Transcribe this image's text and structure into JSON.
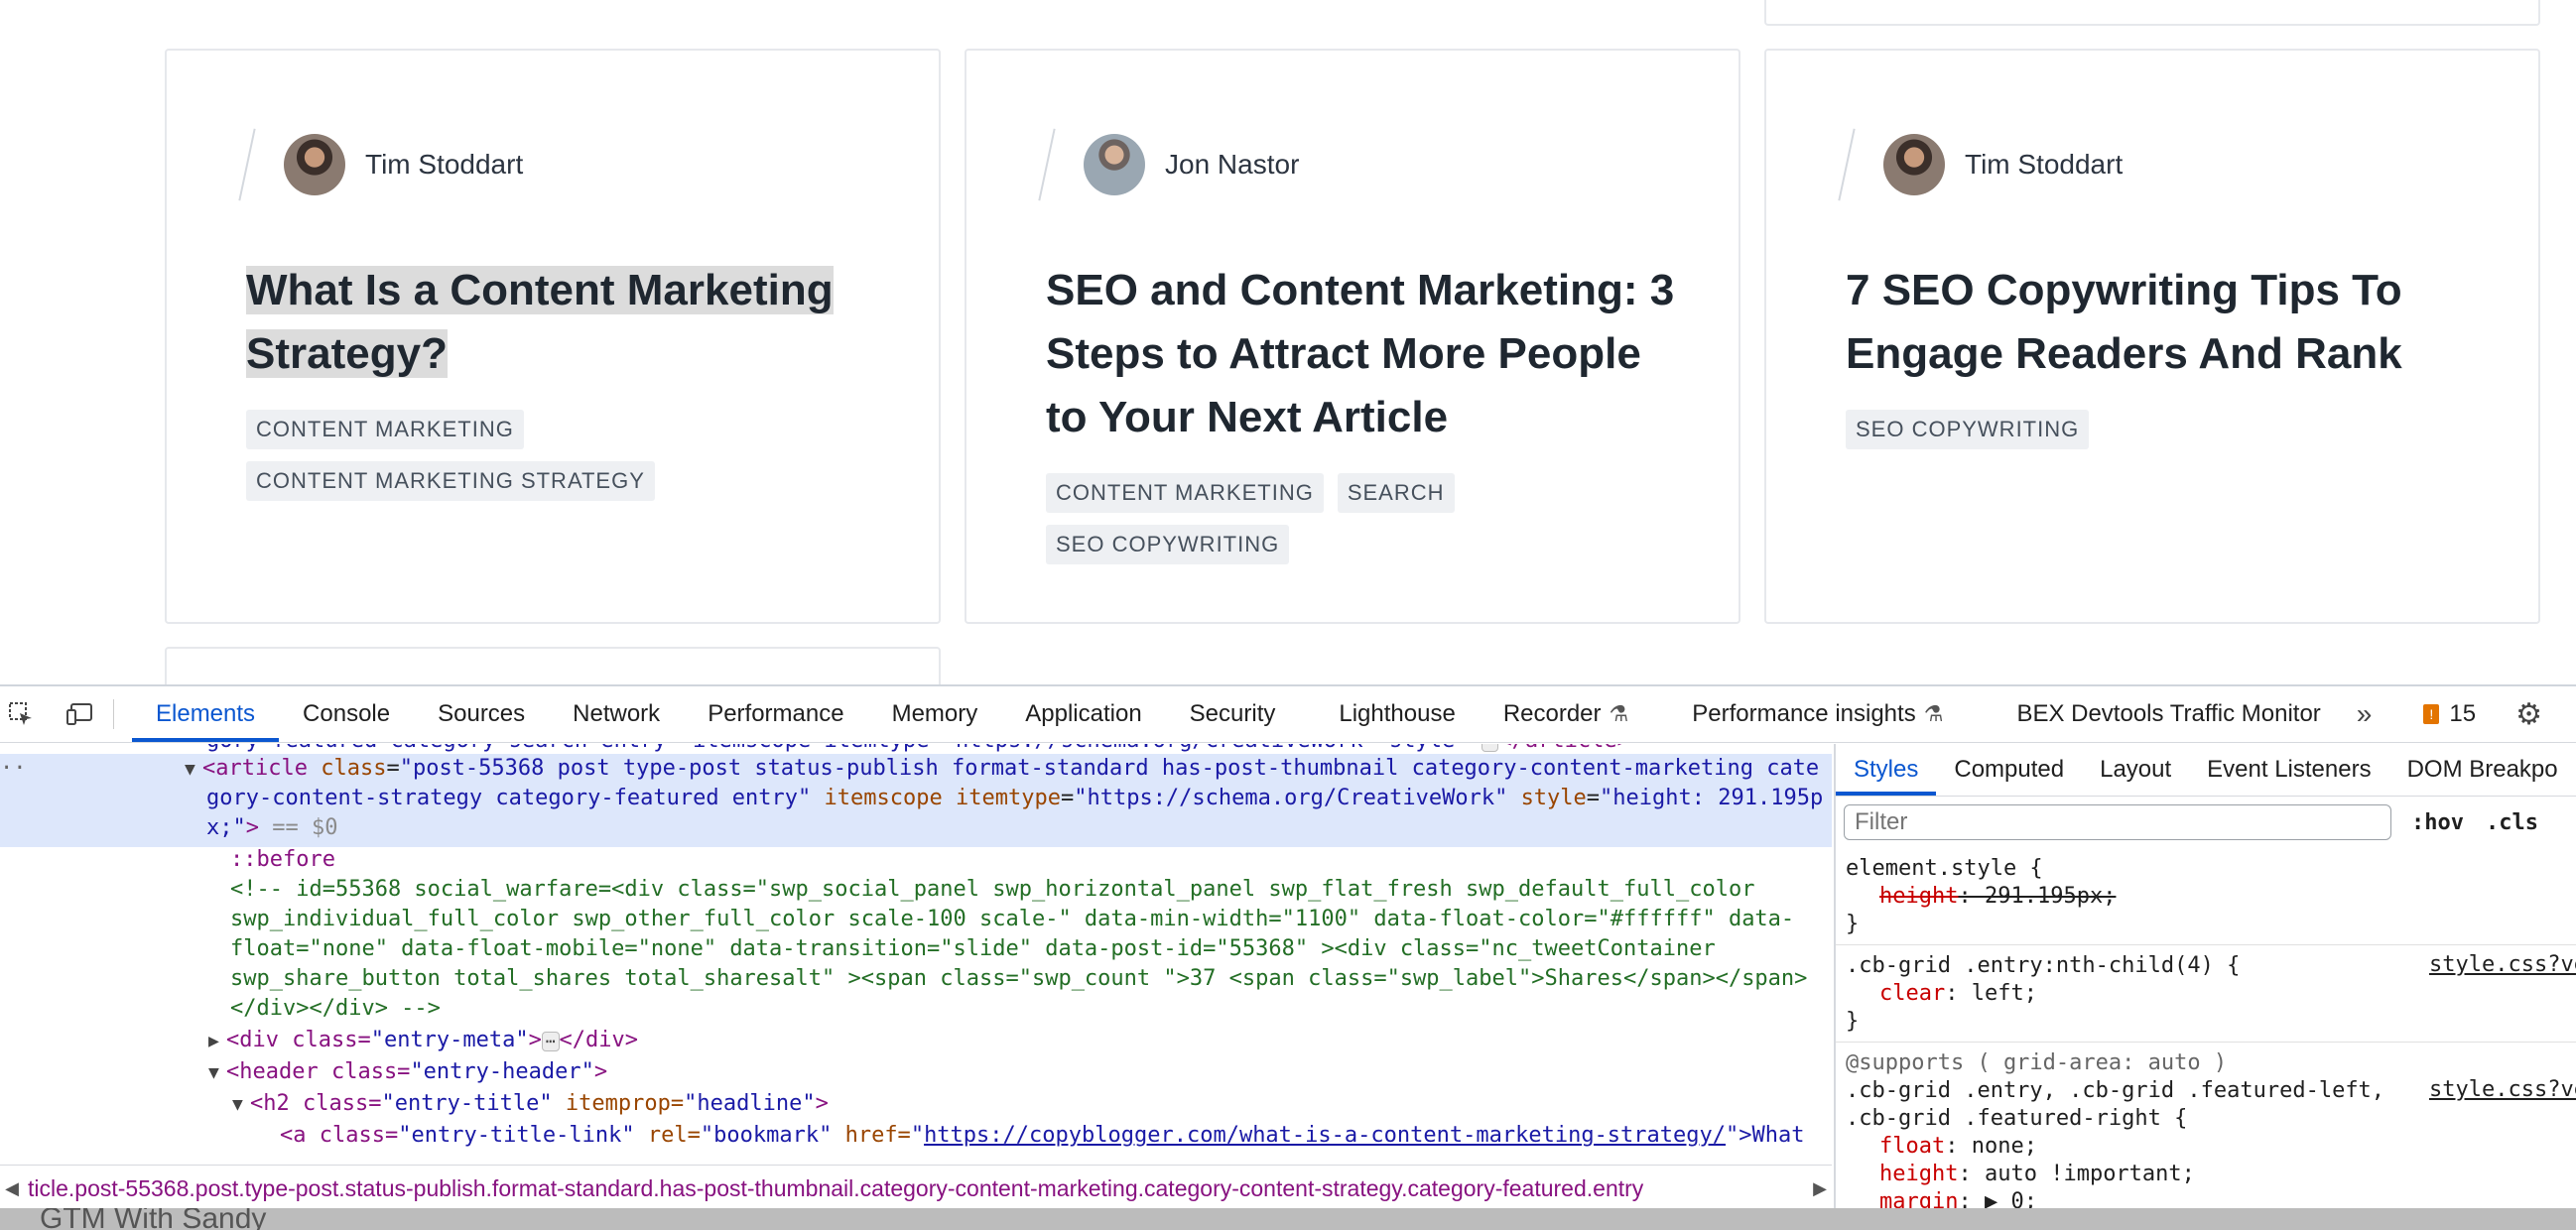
{
  "cards": [
    {
      "author": "Tim Stoddart",
      "title": "What Is a Content Marketing Strategy?",
      "tags": [
        "CONTENT MARKETING",
        "CONTENT MARKETING STRATEGY"
      ]
    },
    {
      "author": "Jon Nastor",
      "title": "SEO and Content Marketing: 3 Steps to Attract More People to Your Next Article",
      "tags": [
        "CONTENT MARKETING",
        "SEARCH",
        "SEO COPYWRITING"
      ]
    },
    {
      "author": "Tim Stoddart",
      "title": "7 SEO Copywriting Tips To Engage Readers And Rank",
      "tags": [
        "SEO COPYWRITING"
      ]
    }
  ],
  "devtools": {
    "tabs": [
      "Elements",
      "Console",
      "Sources",
      "Network",
      "Performance",
      "Memory",
      "Application",
      "Security",
      "Lighthouse",
      "Recorder",
      "Performance insights",
      "BEX Devtools Traffic Monitor"
    ],
    "overflow": "»",
    "issues_count": "15",
    "styles_tabs": [
      "Styles",
      "Computed",
      "Layout",
      "Event Listeners",
      "DOM Breakpo"
    ],
    "filter_placeholder": "Filter",
    "hov": ":hov",
    "cls": ".cls",
    "dom": {
      "top_cut": "gory-featured category-search entry\" itemscope itemtype=\"https://schema.org/CreativeWork\" style=\"",
      "article_tag": "<article",
      "article_class_attr": "class",
      "article_class_val1": "\"post-55368 post type-post status-publish format-standard has-post-thumbnail category-content-marketing cate",
      "article_class_val2": "gory-content-strategy category-featured entry\"",
      "itemscope": "itemscope",
      "itemtype_attr": "itemtype",
      "itemtype_val": "\"https://schema.org/CreativeWork\"",
      "style_attr": "style",
      "style_val1": "\"height: 291.195p",
      "style_val2": "x;\"",
      "eq0": "== $0",
      "before": "::before",
      "comment1": "<!-- id=55368 social_warfare=<div class=\"swp_social_panel swp_horizontal_panel swp_flat_fresh  swp_default_full_color",
      "comment2": "swp_individual_full_color swp_other_full_color scale-100  scale-\" data-min-width=\"1100\" data-float-color=\"#ffffff\" data-",
      "comment3": "float=\"none\" data-float-mobile=\"none\" data-transition=\"slide\" data-post-id=\"55368\" ><div class=\"nc_tweetContainer",
      "comment4": "swp_share_button total_shares total_sharesalt\" ><span class=\"swp_count \">37 <span class=\"swp_label\">Shares</span></span>",
      "comment5": "</div></div> -->",
      "entry_meta_open": "<div class=",
      "entry_meta_val": "\"entry-meta\"",
      "entry_meta_close": "</div>",
      "header_open": "<header class=",
      "header_val": "\"entry-header\"",
      "h2_open": "<h2 class=",
      "h2_class_val": "\"entry-title\"",
      "h2_itemprop": "itemprop=",
      "h2_itemprop_val": "\"headline\"",
      "a_open": "<a class=",
      "a_class_val": "\"entry-title-link\"",
      "a_rel": "rel=",
      "a_rel_val": "\"bookmark\"",
      "a_href": "href=",
      "a_href_val": "https://copyblogger.com/what-is-a-content-marketing-strategy/",
      "a_after": "\">What"
    },
    "styles": {
      "element_style": "element.style {",
      "element_prop": "height",
      "element_val": "291.195px;",
      "rule2_sel": ".cb-grid .entry:nth-child(4) {",
      "rule2_prop": "clear",
      "rule2_val": "left;",
      "rule2_src": "style.css?ve",
      "rule3_supports": "@supports ( grid-area: auto )",
      "rule3_sel1": ".cb-grid .entry, .cb-grid .featured-left,",
      "rule3_sel2": ".cb-grid .featured-right {",
      "rule3_src": "style.css?ve",
      "rule3_p1": "float",
      "rule3_v1": "none;",
      "rule3_p2": "height",
      "rule3_v2": "auto !important;",
      "rule3_p3": "margin",
      "rule3_v3": "0;",
      "close": "}"
    },
    "breadcrumb": "ticle.post-55368.post.type-post.status-publish.format-standard.has-post-thumbnail.category-content-marketing.category-content-strategy.category-featured.entry"
  },
  "taskbar_text": "GTM With Sandy"
}
